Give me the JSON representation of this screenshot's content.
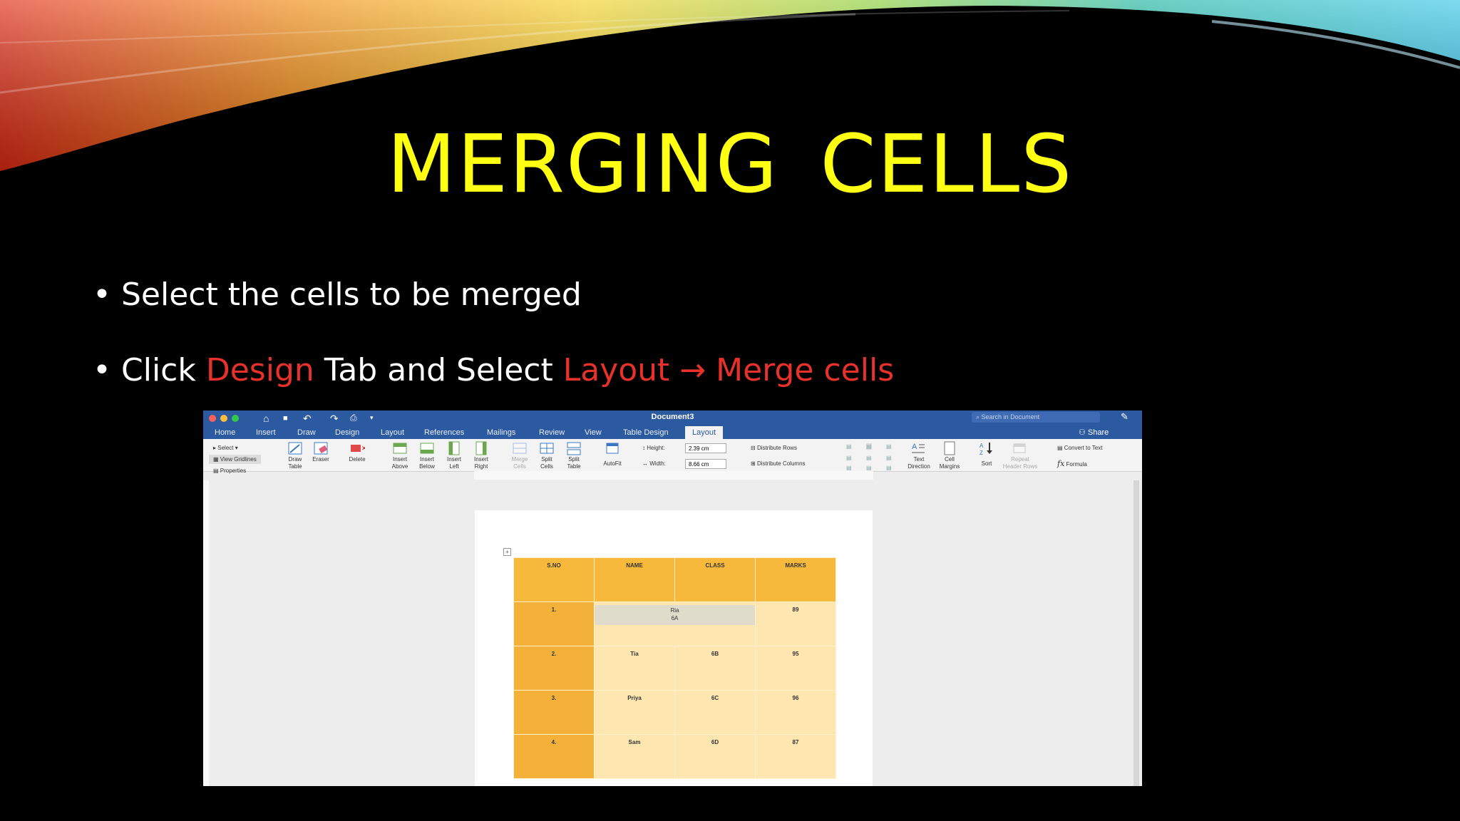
{
  "slide": {
    "title_word1": "MERGING",
    "title_word2": "CELLS",
    "bullet1": "Select the cells to be merged",
    "bullet2": {
      "click": "Click ",
      "design": "Design",
      "tab_and_select": " Tab and Select ",
      "layout": "Layout",
      "arrow": " → ",
      "merge": " Merge cells"
    },
    "colors": {
      "title": "#ffff14",
      "highlight": "#e8312b",
      "background": "#000000"
    }
  },
  "screenshot": {
    "window_title": "Document3",
    "search_placeholder": "Search in Document",
    "share_label": "Share",
    "tabs": [
      "Home",
      "Insert",
      "Draw",
      "Design",
      "Layout",
      "References",
      "Mailings",
      "Review",
      "View",
      "Table Design",
      "Layout"
    ],
    "active_tab": "Layout",
    "ribbon": {
      "select": "Select",
      "view_gridlines": "View Gridlines",
      "properties": "Properties",
      "draw_table": [
        "Draw",
        "Table"
      ],
      "eraser": "Eraser",
      "delete": "Delete",
      "insert_above": [
        "Insert",
        "Above"
      ],
      "insert_below": [
        "Insert",
        "Below"
      ],
      "insert_left": [
        "Insert",
        "Left"
      ],
      "insert_right": [
        "Insert",
        "Right"
      ],
      "merge_cells": [
        "Merge",
        "Cells"
      ],
      "split_cells": [
        "Split",
        "Cells"
      ],
      "split_table": [
        "Split",
        "Table"
      ],
      "autofit": "AutoFit",
      "height_label": "Height:",
      "height_value": "2.39 cm",
      "width_label": "Width:",
      "width_value": "8.66 cm",
      "distribute_rows": "Distribute Rows",
      "distribute_columns": "Distribute Columns",
      "text_direction": [
        "Text",
        "Direction"
      ],
      "cell_margins": [
        "Cell",
        "Margins"
      ],
      "sort": "Sort",
      "repeat_header_rows": [
        "Repeat",
        "Header Rows"
      ],
      "convert_to_text": "Convert to Text",
      "formula": "Formula"
    },
    "table": {
      "headers": [
        "S.NO",
        "NAME",
        "CLASS",
        "MARKS"
      ],
      "merged_row": {
        "sno": "1.",
        "line1": "Ria",
        "line2": "6A",
        "marks": "89"
      },
      "rows": [
        [
          "2.",
          "Tia",
          "6B",
          "95"
        ],
        [
          "3.",
          "Priya",
          "6C",
          "96"
        ],
        [
          "4.",
          "Sam",
          "6D",
          "87"
        ]
      ]
    }
  }
}
